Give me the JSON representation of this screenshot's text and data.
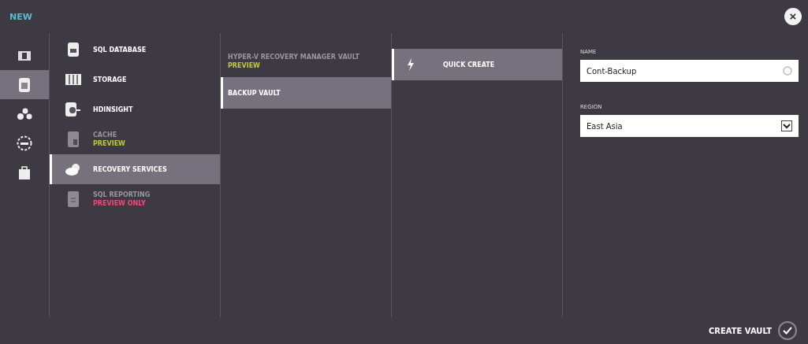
{
  "header": {
    "title": "NEW",
    "close": "×"
  },
  "categories": [
    {
      "kind": "compute",
      "selected": false
    },
    {
      "kind": "data",
      "selected": true
    },
    {
      "kind": "services",
      "selected": false
    },
    {
      "kind": "network",
      "selected": false
    },
    {
      "kind": "store",
      "selected": false
    }
  ],
  "services": [
    {
      "kind": "database",
      "name": "SQL DATABASE",
      "disabled": false,
      "selected": false
    },
    {
      "kind": "storage",
      "name": "STORAGE",
      "disabled": false,
      "selected": false
    },
    {
      "kind": "hdinsight",
      "name": "HDINSIGHT",
      "disabled": false,
      "selected": false
    },
    {
      "kind": "cache",
      "name": "CACHE",
      "subtitle": "PREVIEW",
      "color": "#c2c83e",
      "disabled": true,
      "selected": false
    },
    {
      "kind": "recovery",
      "name": "RECOVERY SERVICES",
      "disabled": false,
      "selected": true
    },
    {
      "kind": "reporting",
      "name": "SQL REPORTING",
      "subtitle": "PREVIEW ONLY",
      "color": "#f04a78",
      "disabled": true,
      "selected": false
    }
  ],
  "vault_types": [
    {
      "name": "HYPER-V RECOVERY MANAGER VAULT",
      "subtitle": "PREVIEW",
      "color": "#c2c83e",
      "disabled": true,
      "selected": false
    },
    {
      "name": "BACKUP VAULT",
      "disabled": false,
      "selected": true
    }
  ],
  "create_options": [
    {
      "name": "QUICK CREATE",
      "selected": true
    }
  ],
  "form": {
    "name_label": "NAME",
    "name_value": "Cont-Backup",
    "region_label": "REGION",
    "region_value": "East Asia"
  },
  "action": {
    "label": "CREATE VAULT"
  }
}
